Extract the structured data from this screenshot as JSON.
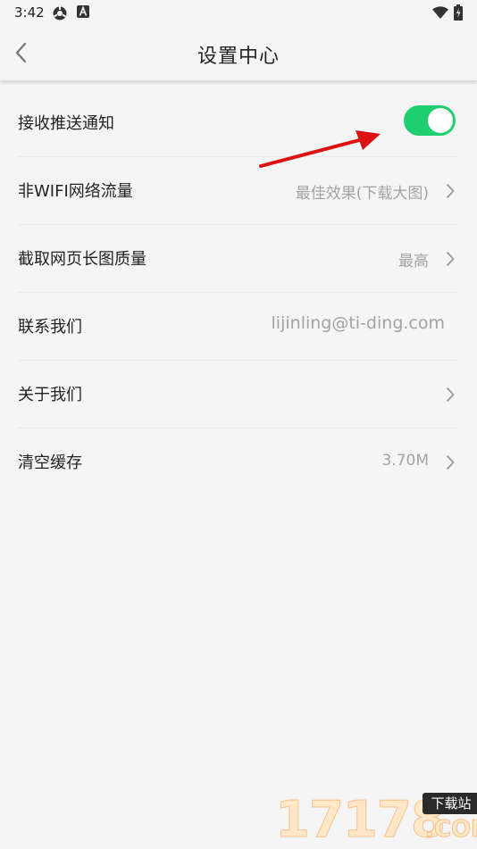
{
  "status_bar": {
    "time": "3:42",
    "icons": [
      "settings-icon",
      "a-icon",
      "wifi-icon",
      "battery-icon"
    ]
  },
  "header": {
    "title": "设置中心",
    "back_icon": "chevron-left-icon"
  },
  "settings": {
    "push": {
      "label": "接收推送通知",
      "enabled": true,
      "toggle_color": "#1fcf6f"
    },
    "non_wifi": {
      "label": "非WIFI网络流量",
      "value": "最佳效果(下载大图)"
    },
    "screenshot_quality": {
      "label": "截取网页长图质量",
      "value": "最高"
    },
    "contact": {
      "label": "联系我们",
      "value": "lijinling@ti-ding.com"
    },
    "about": {
      "label": "关于我们"
    },
    "cache": {
      "label": "清空缓存",
      "value": "3.70M"
    }
  },
  "watermark": {
    "number": "17178",
    "badge": "下载站",
    "suffix": ".COM"
  }
}
